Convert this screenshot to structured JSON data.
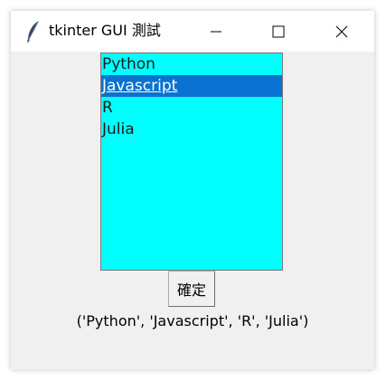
{
  "window": {
    "title": "tkinter GUI 測試",
    "icon": "feather-icon"
  },
  "listbox": {
    "background": "#00ffff",
    "selected_color": "#0a72d0",
    "items": [
      {
        "label": "Python",
        "selected": false
      },
      {
        "label": "Javascript",
        "selected": true
      },
      {
        "label": "R",
        "selected": false
      },
      {
        "label": "Julia",
        "selected": false
      }
    ]
  },
  "button": {
    "label": "確定"
  },
  "result": {
    "text": "('Python', 'Javascript', 'R', 'Julia')"
  }
}
